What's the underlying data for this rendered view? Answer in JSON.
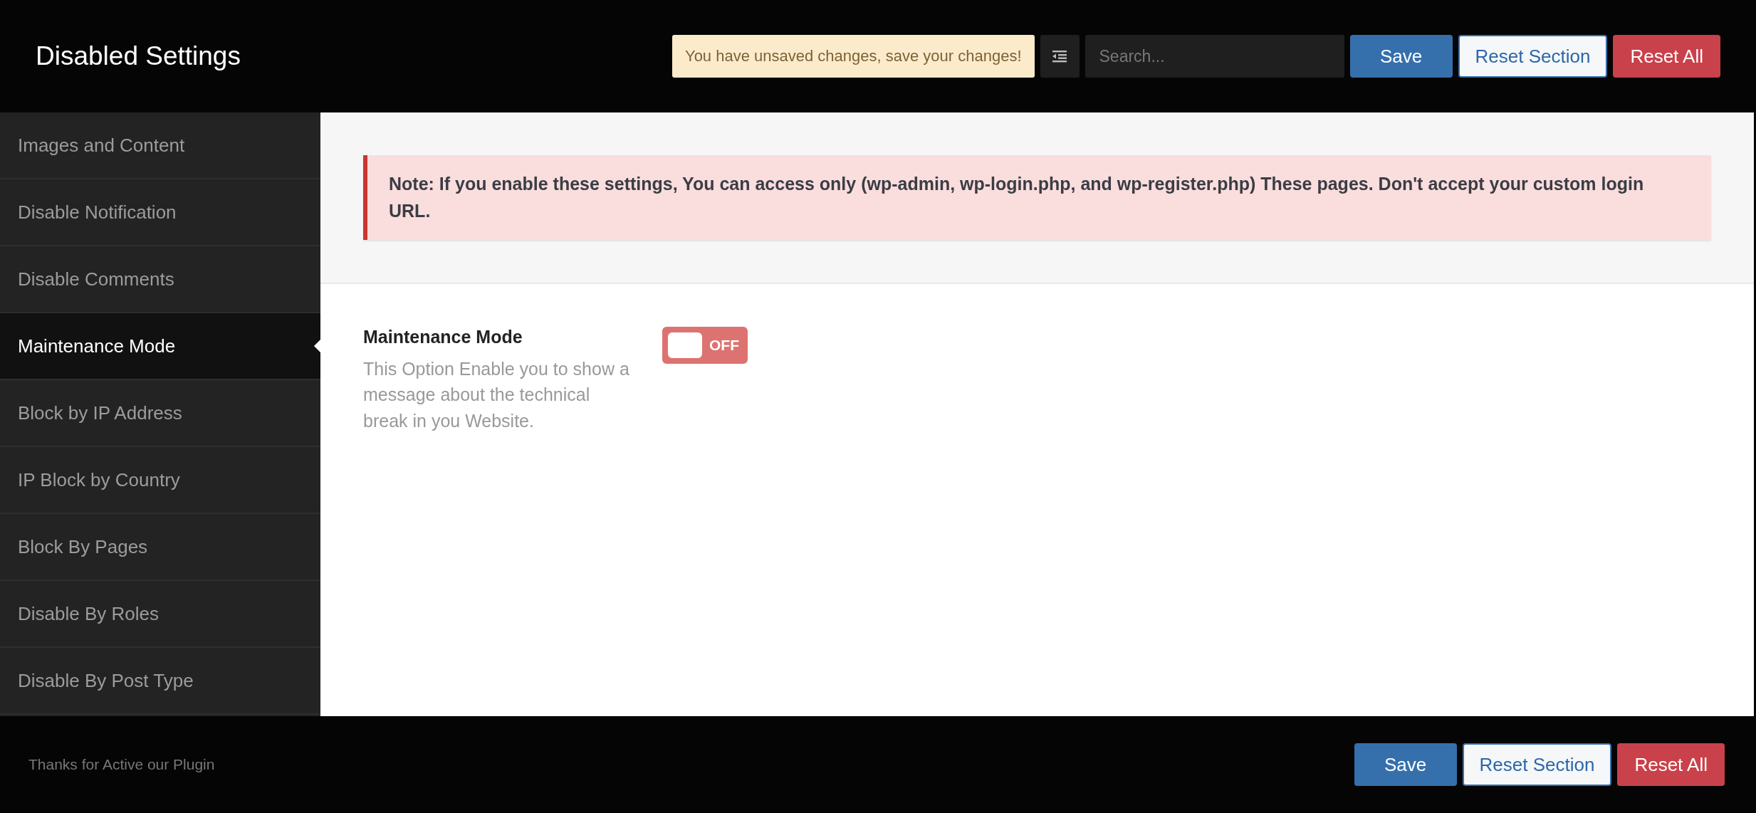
{
  "header": {
    "title": "Disabled Settings",
    "notice": "You have unsaved changes, save your changes!",
    "search": {
      "placeholder": "Search..."
    },
    "buttons": [
      {
        "kind": "save",
        "label": "Save"
      },
      {
        "kind": "reset-section",
        "label": "Reset Section"
      },
      {
        "kind": "reset-all",
        "label": "Reset All"
      }
    ]
  },
  "sidebar": {
    "items": [
      {
        "label": "Images and Content",
        "selected": false
      },
      {
        "label": "Disable Notification",
        "selected": false
      },
      {
        "label": "Disable Comments",
        "selected": false
      },
      {
        "label": "Maintenance Mode",
        "selected": true
      },
      {
        "label": "Block by IP Address",
        "selected": false
      },
      {
        "label": "IP Block by Country",
        "selected": false
      },
      {
        "label": "Block By Pages",
        "selected": false
      },
      {
        "label": "Disable By Roles",
        "selected": false
      },
      {
        "label": "Disable By Post Type",
        "selected": false
      }
    ]
  },
  "content": {
    "note": "Note: If you enable these settings, You can access only (wp-admin, wp-login.php, and wp-register.php) These pages. Don't accept your custom login URL.",
    "fields": [
      {
        "title": "Maintenance Mode",
        "description": "This Option Enable you to show a message about the technical break in you Website.",
        "on": false,
        "toggle_label": "OFF"
      }
    ]
  },
  "footer": {
    "text": "Thanks for Active our Plugin",
    "buttons": [
      {
        "kind": "save",
        "label": "Save"
      },
      {
        "kind": "reset-section",
        "label": "Reset Section"
      },
      {
        "kind": "reset-all",
        "label": "Reset All"
      }
    ]
  }
}
